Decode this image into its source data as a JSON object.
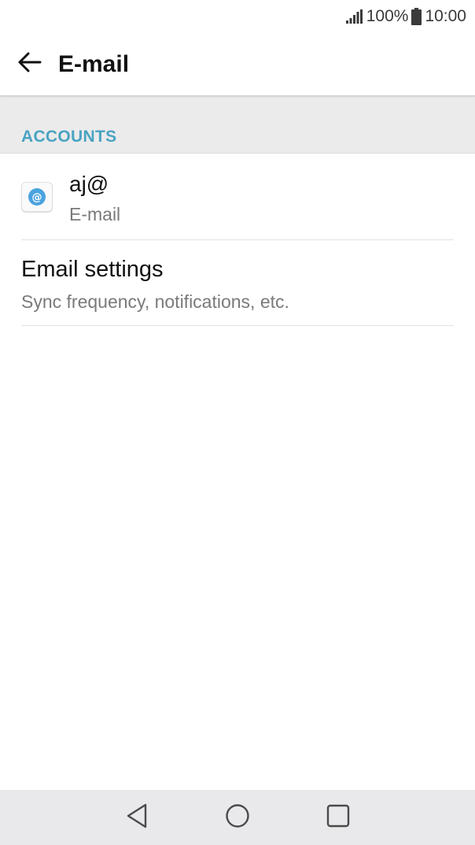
{
  "status_bar": {
    "battery_percent": "100%",
    "time": "10:00",
    "signal_icon": "signal-icon",
    "battery_icon": "battery-icon"
  },
  "app_bar": {
    "title": "E-mail",
    "back_icon": "arrow-back-icon"
  },
  "section": {
    "header": "ACCOUNTS"
  },
  "account": {
    "name": "aj@",
    "type": "E-mail",
    "icon": "at-sign-icon"
  },
  "settings": {
    "title": "Email settings",
    "subtitle": "Sync frequency, notifications, etc."
  },
  "nav_bar": {
    "back_icon": "triangle-back-icon",
    "home_icon": "circle-home-icon",
    "recents_icon": "square-recents-icon"
  },
  "colors": {
    "accent": "#4aa3c3",
    "section_bg": "#ebebeb",
    "nav_bg": "#e9e9eb"
  }
}
